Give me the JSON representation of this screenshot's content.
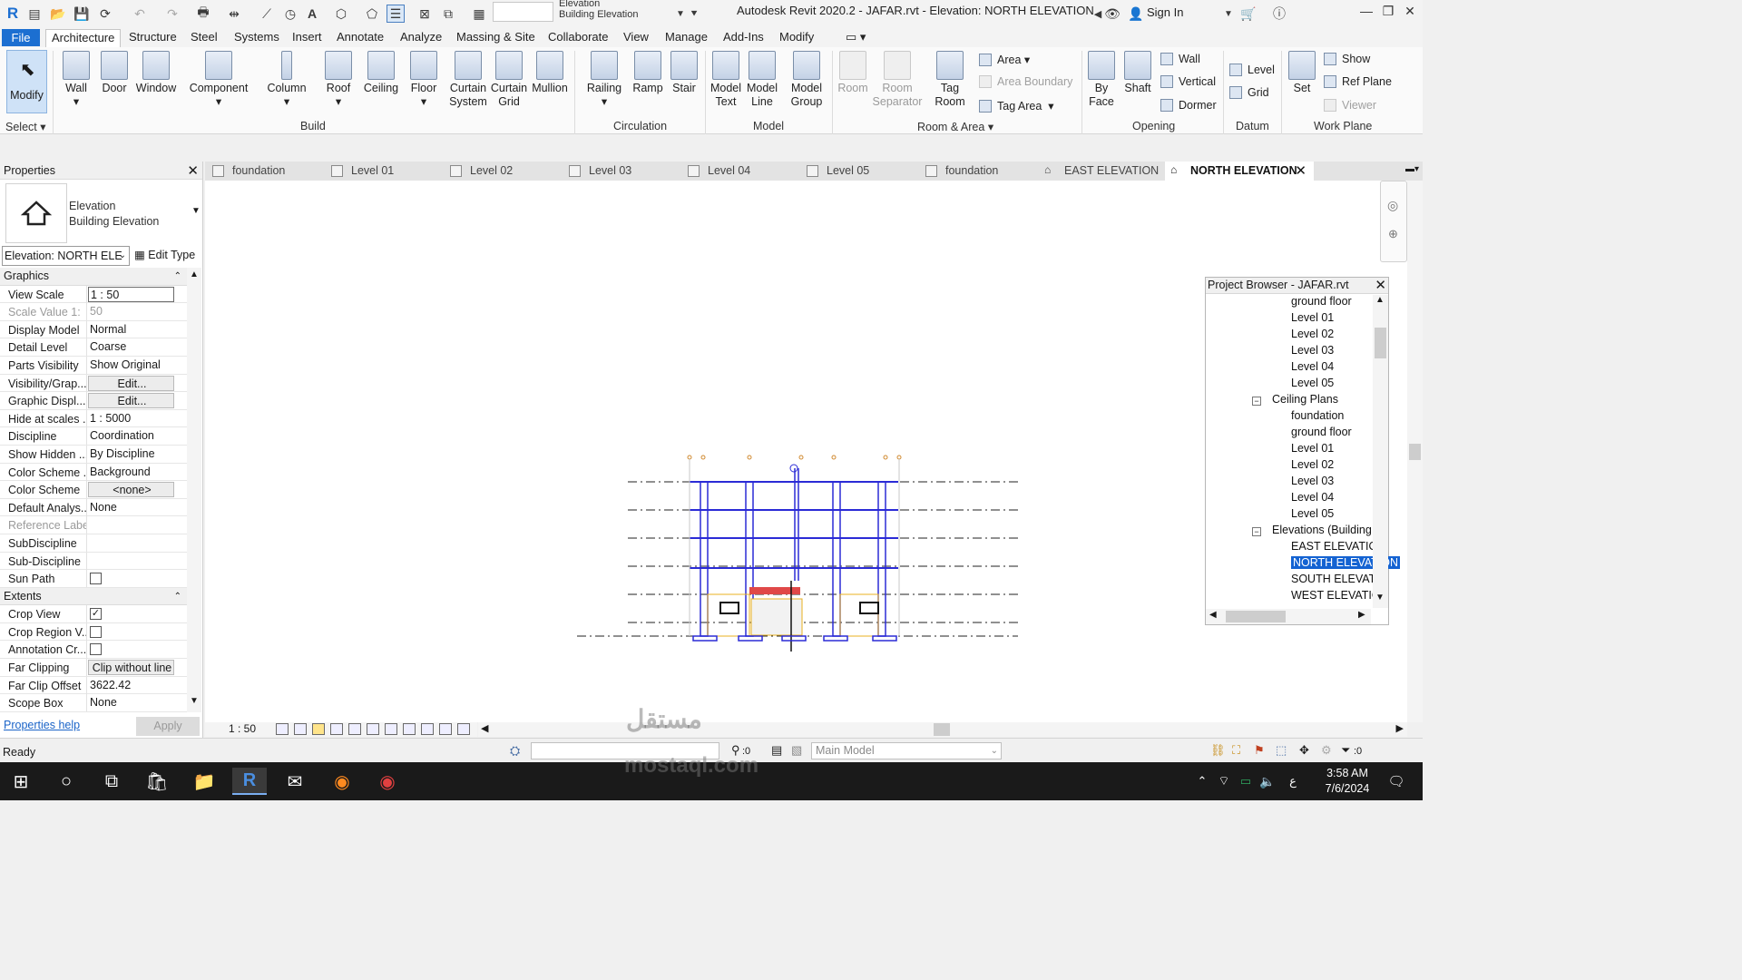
{
  "app": {
    "title": "Autodesk Revit 2020.2 - JAFAR.rvt - Elevation: NORTH ELEVATION",
    "sign_in": "Sign In",
    "type_selector_line1": "Elevation",
    "type_selector_line2": "Building Elevation"
  },
  "ribbon_tabs": [
    "File",
    "Architecture",
    "Structure",
    "Steel",
    "Systems",
    "Insert",
    "Annotate",
    "Analyze",
    "Massing & Site",
    "Collaborate",
    "View",
    "Manage",
    "Add-Ins",
    "Modify"
  ],
  "ribbon": {
    "modify": "Modify",
    "select_label": "Select",
    "build": {
      "wall": "Wall",
      "door": "Door",
      "window": "Window",
      "component": "Component",
      "column": "Column",
      "roof": "Roof",
      "ceiling": "Ceiling",
      "floor": "Floor",
      "curtain_system_1": "Curtain",
      "curtain_system_2": "System",
      "curtain_grid_1": "Curtain",
      "curtain_grid_2": "Grid",
      "mullion": "Mullion",
      "label": "Build"
    },
    "circulation": {
      "railing": "Railing",
      "ramp": "Ramp",
      "stair": "Stair",
      "label": "Circulation"
    },
    "model": {
      "model_text_1": "Model",
      "model_text_2": "Text",
      "model_line_1": "Model",
      "model_line_2": "Line",
      "model_group_1": "Model",
      "model_group_2": "Group",
      "label": "Model"
    },
    "room_area": {
      "room": "Room",
      "room_sep_1": "Room",
      "room_sep_2": "Separator",
      "tag_room_1": "Tag",
      "tag_room_2": "Room",
      "area": "Area",
      "area_boundary": "Area  Boundary",
      "tag_area": "Tag  Area",
      "label": "Room & Area"
    },
    "opening": {
      "by_face_1": "By",
      "by_face_2": "Face",
      "shaft": "Shaft",
      "wall": "Wall",
      "vertical": "Vertical",
      "dormer": "Dormer",
      "label": "Opening"
    },
    "datum": {
      "level": "Level",
      "grid": "Grid",
      "label": "Datum"
    },
    "work_plane": {
      "set": "Set",
      "show": "Show",
      "ref_plane": "Ref  Plane",
      "viewer": "Viewer",
      "label": "Work Plane"
    }
  },
  "properties": {
    "title": "Properties",
    "type_line1": "Elevation",
    "type_line2": "Building Elevation",
    "instance_selector": "Elevation: NORTH ELE",
    "edit_type": "Edit Type",
    "groups": [
      {
        "name": "Graphics",
        "rows": [
          {
            "key": "View Scale",
            "value": "1 : 50",
            "style": "box"
          },
          {
            "key": "Scale Value    1:",
            "value": "50",
            "style": "grey"
          },
          {
            "key": "Display Model",
            "value": "Normal",
            "style": ""
          },
          {
            "key": "Detail Level",
            "value": "Coarse",
            "style": ""
          },
          {
            "key": "Parts Visibility",
            "value": "Show Original",
            "style": ""
          },
          {
            "key": "Visibility/Grap...",
            "value": "Edit...",
            "style": "btn"
          },
          {
            "key": "Graphic Displ...",
            "value": "Edit...",
            "style": "btn"
          },
          {
            "key": "Hide at scales ...",
            "value": "1 : 5000",
            "style": ""
          },
          {
            "key": "Discipline",
            "value": "Coordination",
            "style": ""
          },
          {
            "key": "Show Hidden ...",
            "value": "By Discipline",
            "style": ""
          },
          {
            "key": "Color Scheme ...",
            "value": "Background",
            "style": ""
          },
          {
            "key": "Color Scheme",
            "value": "<none>",
            "style": "btn"
          },
          {
            "key": "Default Analys...",
            "value": "None",
            "style": ""
          },
          {
            "key": "Reference Label",
            "value": "",
            "style": "grey"
          },
          {
            "key": "SubDiscipline",
            "value": "",
            "style": ""
          },
          {
            "key": "Sub-Discipline",
            "value": "",
            "style": ""
          },
          {
            "key": "Sun Path",
            "value": "",
            "style": "check-off"
          }
        ]
      },
      {
        "name": "Extents",
        "rows": [
          {
            "key": "Crop View",
            "value": "",
            "style": "check-on"
          },
          {
            "key": "Crop Region V...",
            "value": "",
            "style": "check-off"
          },
          {
            "key": "Annotation Cr...",
            "value": "",
            "style": "check-off"
          },
          {
            "key": "Far Clipping",
            "value": "Clip without line",
            "style": "btn"
          },
          {
            "key": "Far Clip Offset",
            "value": "3622.42",
            "style": ""
          },
          {
            "key": "Scope Box",
            "value": "None",
            "style": ""
          }
        ]
      }
    ],
    "help_link": "Properties help",
    "apply": "Apply"
  },
  "view_tabs": [
    {
      "label": "foundation",
      "active": false
    },
    {
      "label": "Level 01",
      "active": false
    },
    {
      "label": "Level 02",
      "active": false
    },
    {
      "label": "Level 03",
      "active": false
    },
    {
      "label": "Level 04",
      "active": false
    },
    {
      "label": "Level 05",
      "active": false
    },
    {
      "label": "foundation",
      "active": false
    },
    {
      "label": "EAST ELEVATION",
      "active": false
    },
    {
      "label": "NORTH ELEVATION",
      "active": true
    }
  ],
  "view_control": {
    "scale": "1 : 50"
  },
  "project_browser": {
    "title": "Project Browser - JAFAR.rvt",
    "items": [
      {
        "label": "ground floor",
        "indent": 2,
        "toggle": "",
        "selected": false
      },
      {
        "label": "Level 01",
        "indent": 2,
        "toggle": "",
        "selected": false
      },
      {
        "label": "Level 02",
        "indent": 2,
        "toggle": "",
        "selected": false
      },
      {
        "label": "Level 03",
        "indent": 2,
        "toggle": "",
        "selected": false
      },
      {
        "label": "Level 04",
        "indent": 2,
        "toggle": "",
        "selected": false
      },
      {
        "label": "Level 05",
        "indent": 2,
        "toggle": "",
        "selected": false
      },
      {
        "label": "Ceiling Plans",
        "indent": 1,
        "toggle": "−",
        "selected": false
      },
      {
        "label": "foundation",
        "indent": 2,
        "toggle": "",
        "selected": false
      },
      {
        "label": "ground floor",
        "indent": 2,
        "toggle": "",
        "selected": false
      },
      {
        "label": "Level 01",
        "indent": 2,
        "toggle": "",
        "selected": false
      },
      {
        "label": "Level 02",
        "indent": 2,
        "toggle": "",
        "selected": false
      },
      {
        "label": "Level 03",
        "indent": 2,
        "toggle": "",
        "selected": false
      },
      {
        "label": "Level 04",
        "indent": 2,
        "toggle": "",
        "selected": false
      },
      {
        "label": "Level 05",
        "indent": 2,
        "toggle": "",
        "selected": false
      },
      {
        "label": "Elevations (Building",
        "indent": 1,
        "toggle": "−",
        "selected": false
      },
      {
        "label": "EAST ELEVATION",
        "indent": 2,
        "toggle": "",
        "selected": false
      },
      {
        "label": "NORTH ELEVATION",
        "indent": 2,
        "toggle": "",
        "selected": true
      },
      {
        "label": "SOUTH ELEVATI",
        "indent": 2,
        "toggle": "",
        "selected": false
      },
      {
        "label": "WEST ELEVATIO",
        "indent": 2,
        "toggle": "",
        "selected": false
      }
    ]
  },
  "status": {
    "ready": "Ready",
    "selection_count": ":0",
    "model": "Main Model",
    "filter_count": ":0"
  },
  "taskbar": {
    "time": "3:58 AM",
    "date": "7/6/2024",
    "lang": "ع",
    "notifications": "1"
  },
  "watermark": {
    "arabic": "مستقل",
    "latin": "mostaql.com"
  },
  "colors": {
    "accent": "#1463d2",
    "file_tab": "#1c6fd1",
    "grid_lines": "#2b2bd6",
    "taskbar": "#1a1a1a"
  }
}
